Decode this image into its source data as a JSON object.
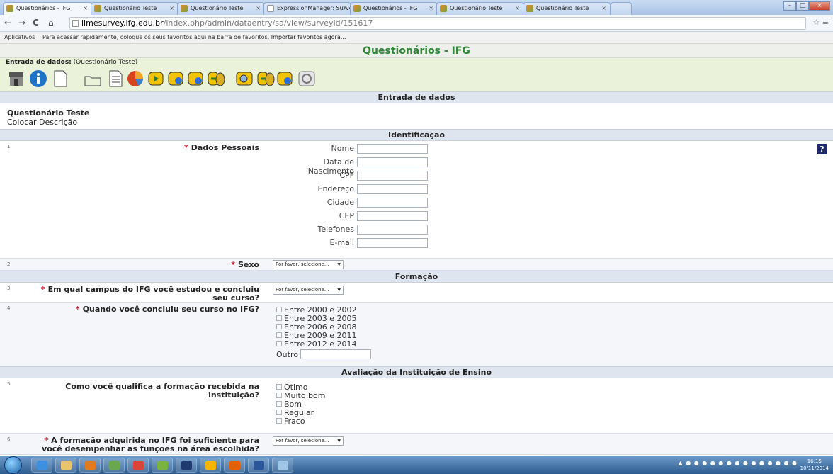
{
  "browser": {
    "tabs": [
      {
        "title": "Questionários - IFG"
      },
      {
        "title": "Questionário Teste"
      },
      {
        "title": "Questionário Teste"
      },
      {
        "title": "ExpressionManager: Surve"
      },
      {
        "title": "Questionários - IFG"
      },
      {
        "title": "Questionário Teste"
      },
      {
        "title": "Questionário Teste"
      }
    ],
    "url_host": "limesurvey.ifg.edu.br",
    "url_path": "/index.php/admin/dataentry/sa/view/surveyid/151617",
    "bookmarks": {
      "apps": "Aplicativos",
      "hint": "Para acessar rapidamente, coloque os seus favoritos aqui na barra de favoritos.",
      "import_link": "Importar favoritos agora..."
    }
  },
  "site_title": "Questionários - IFG",
  "entry_header": {
    "label": "Entrada de dados:",
    "survey": "(Questionário Teste)"
  },
  "toolbar_icons": [
    "home-icon",
    "info-icon",
    "blank-page-icon",
    "folder-open-icon",
    "document-icon",
    "pie-chart-icon",
    "export-icon",
    "export-icon",
    "export-icon",
    "import-icon",
    "view-icon",
    "import-icon",
    "export-icon",
    "refresh-icon"
  ],
  "section_entry": "Entrada de dados",
  "survey": {
    "title": "Questionário Teste",
    "description": "Colocar Descrição"
  },
  "groups": {
    "g1": "Identificação",
    "g2": "Formação",
    "g3": "Avaliação da Instituição de Ensino"
  },
  "req": "*",
  "questions": {
    "q1": {
      "num": "1",
      "text": "Dados Pessoais",
      "help": "?",
      "fields": [
        "Nome",
        "Data de Nascimento",
        "CPF",
        "Endereço",
        "Cidade",
        "CEP",
        "Telefones",
        "E-mail"
      ]
    },
    "q2": {
      "num": "2",
      "text": "Sexo",
      "select": "Por favor, selecione..."
    },
    "q3": {
      "num": "3",
      "text": "Em qual campus do IFG você estudou e concluiu seu curso?",
      "select": "Por favor, selecione..."
    },
    "q4": {
      "num": "4",
      "text": "Quando você concluiu seu curso no IFG?",
      "options": [
        "Entre 2000 e 2002",
        "Entre 2003 e 2005",
        "Entre 2006 e 2008",
        "Entre 2009 e 2011",
        "Entre 2012 e 2014"
      ],
      "other": "Outro"
    },
    "q5": {
      "num": "5",
      "text": "Como você qualifica a formação recebida na instituição?",
      "options": [
        "Ótimo",
        "Muito bom",
        "Bom",
        "Regular",
        "Fraco"
      ]
    },
    "q6": {
      "num": "6",
      "text": "A formação adquirida no IFG foi suficiente para você desempenhar as funções na área escolhida?",
      "select": "Por favor, selecione..."
    }
  },
  "taskbar": {
    "time": "16:15",
    "date": "10/11/2014"
  }
}
